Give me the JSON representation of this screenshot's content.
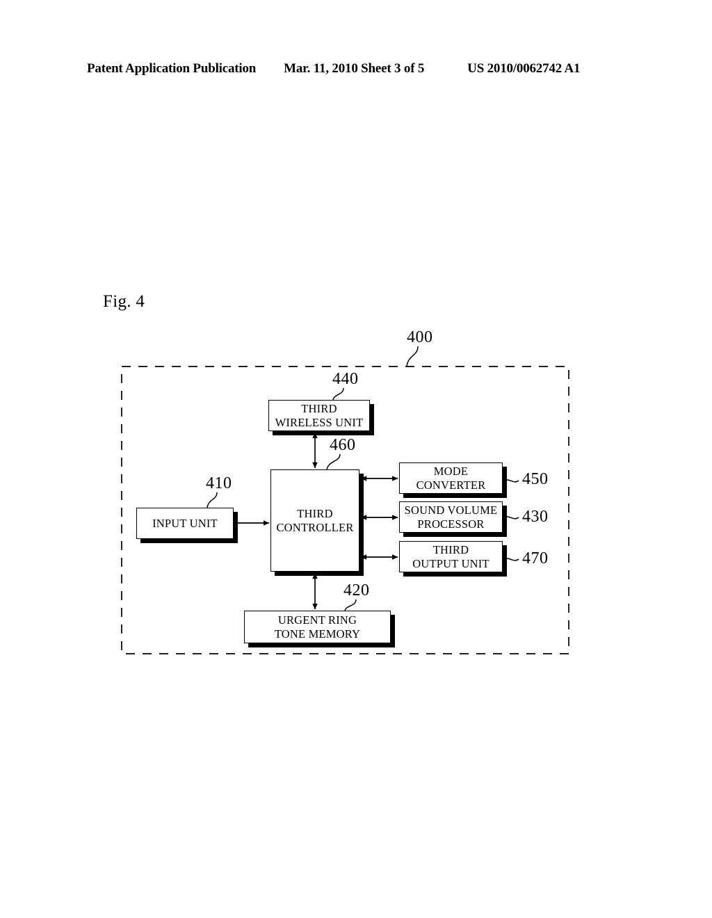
{
  "header": {
    "left": "Patent Application Publication",
    "middle": "Mar. 11, 2010  Sheet 3 of 5",
    "right": "US 2010/0062742 A1"
  },
  "figure": {
    "label": "Fig. 4",
    "system_ref": "400"
  },
  "blocks": [
    {
      "id": "third-wireless-unit",
      "ref": "440",
      "line1": "THIRD",
      "line2": "WIRELESS UNIT"
    },
    {
      "id": "third-controller",
      "ref": "460",
      "line1": "THIRD",
      "line2": "CONTROLLER"
    },
    {
      "id": "input-unit",
      "ref": "410",
      "line1": "INPUT UNIT",
      "line2": ""
    },
    {
      "id": "mode-converter",
      "ref": "450",
      "line1": "MODE",
      "line2": "CONVERTER"
    },
    {
      "id": "sound-volume-processor",
      "ref": "430",
      "line1": "SOUND VOLUME",
      "line2": "PROCESSOR"
    },
    {
      "id": "third-output-unit",
      "ref": "470",
      "line1": "THIRD",
      "line2": "OUTPUT UNIT"
    },
    {
      "id": "urgent-ring-tone-memory",
      "ref": "420",
      "line1": "URGENT RING",
      "line2": "TONE MEMORY"
    }
  ],
  "connections": [
    {
      "from": "third-controller",
      "to": "third-wireless-unit",
      "arrow": "double"
    },
    {
      "from": "third-controller",
      "to": "urgent-ring-tone-memory",
      "arrow": "double"
    },
    {
      "from": "third-controller",
      "to": "mode-converter",
      "arrow": "double"
    },
    {
      "from": "third-controller",
      "to": "sound-volume-processor",
      "arrow": "double"
    },
    {
      "from": "third-controller",
      "to": "third-output-unit",
      "arrow": "double"
    },
    {
      "from": "input-unit",
      "to": "third-controller",
      "arrow": "single"
    }
  ],
  "colors": {
    "ink": "#000000",
    "paper": "#ffffff"
  }
}
